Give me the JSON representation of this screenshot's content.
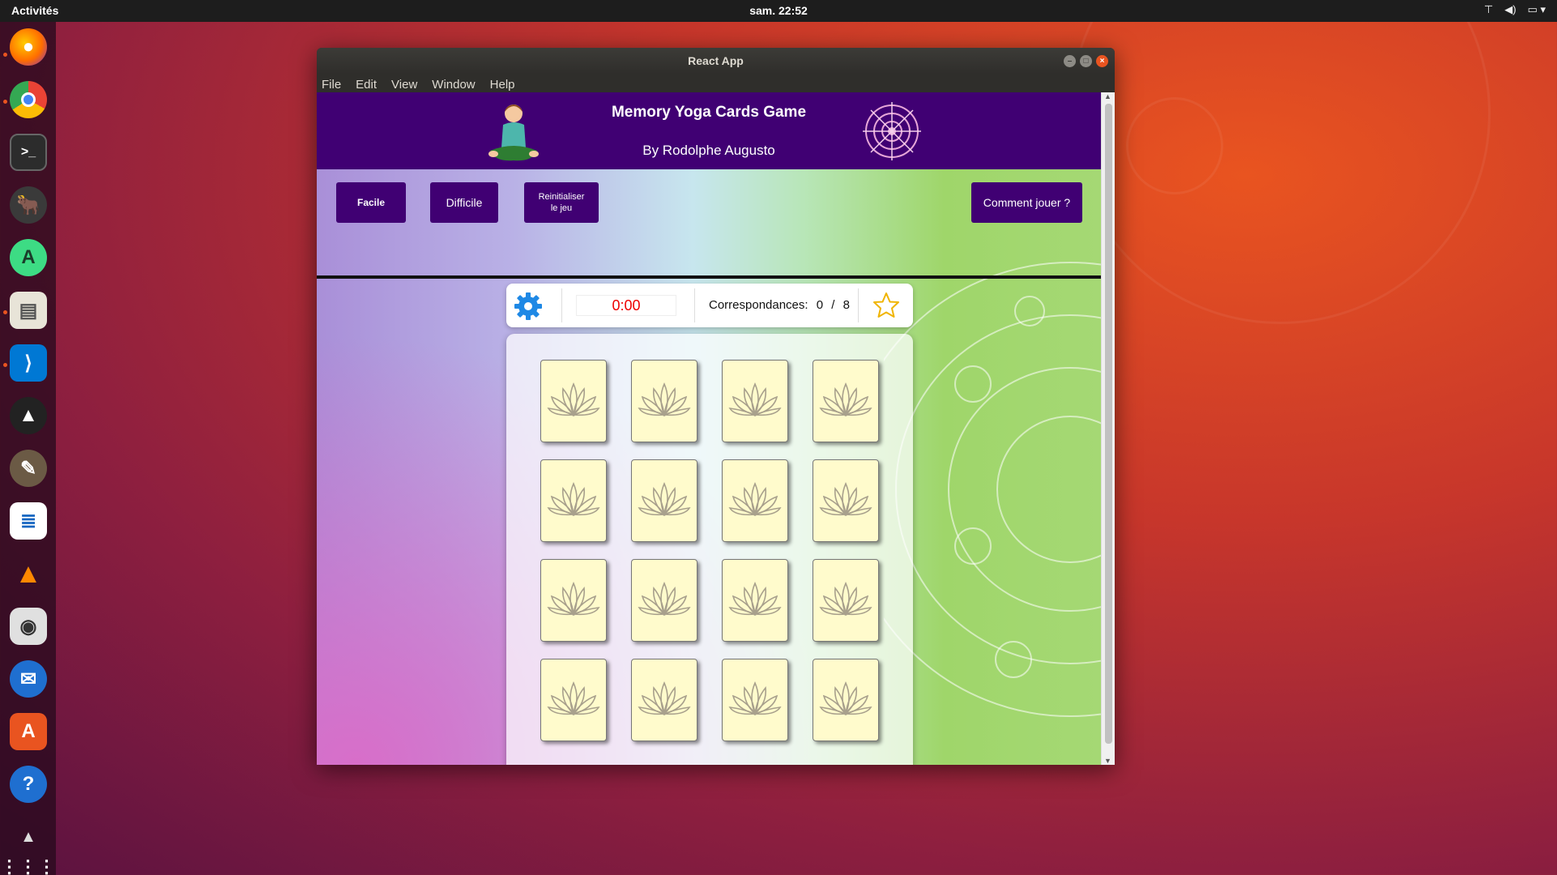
{
  "system": {
    "activities_label": "Activités",
    "clock": "sam. 22:52"
  },
  "dock": {
    "apps": [
      "firefox-icon",
      "chrome-icon",
      "terminal-icon",
      "gnu-icon",
      "android-studio-icon",
      "file-manager-icon",
      "vscode-icon",
      "inkscape-icon",
      "gimp-icon",
      "writer-icon",
      "vlc-icon",
      "speaker-icon",
      "thunderbird-icon",
      "software-center-icon",
      "help-icon",
      "misc-icon",
      "app-grid-icon"
    ]
  },
  "window": {
    "title": "React App",
    "menu": [
      "File",
      "Edit",
      "View",
      "Window",
      "Help"
    ]
  },
  "app": {
    "title": "Memory Yoga Cards Game",
    "author": "By Rodolphe Augusto",
    "buttons": {
      "easy": "Facile",
      "hard": "Difficile",
      "reset_line1": "Reinitialiser",
      "reset_line2": "le jeu",
      "how_to": "Comment jouer ?"
    },
    "status": {
      "timer": "0:00",
      "matches_label": "Correspondances:",
      "matches_found": "0",
      "matches_separator": "/",
      "matches_total": "8"
    },
    "board": {
      "rows": 4,
      "cols": 4,
      "card_icon": "lotus-icon"
    }
  },
  "colors": {
    "header_bg": "#400073",
    "card_bg": "#fffbcc",
    "timer_text": "#e00000",
    "settings_icon": "#1e88e5"
  }
}
